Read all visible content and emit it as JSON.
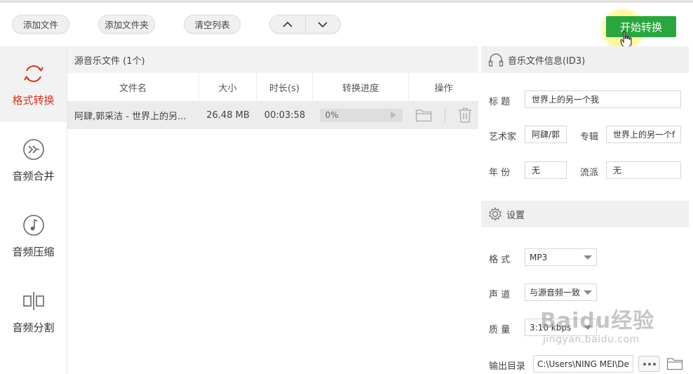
{
  "toolbar": {
    "add_file": "添加文件",
    "add_folder": "添加文件夹",
    "clear_list": "清空列表",
    "start_convert": "开始转换"
  },
  "sidebar": {
    "items": [
      {
        "label": "格式转换",
        "icon": "refresh-icon",
        "active": true
      },
      {
        "label": "音频合并",
        "icon": "merge-icon",
        "active": false
      },
      {
        "label": "音频压缩",
        "icon": "music-note-icon",
        "active": false
      },
      {
        "label": "音频分割",
        "icon": "split-icon",
        "active": false
      }
    ]
  },
  "file_list": {
    "title": "源音乐文件 (1个)",
    "columns": [
      "文件名",
      "大小",
      "时长(s)",
      "转换进度",
      "操作"
    ],
    "rows": [
      {
        "name": "阿肆,郭采洁 - 世界上的另...",
        "size": "26.48 MB",
        "duration": "00:03:58",
        "progress": "0%"
      }
    ]
  },
  "info": {
    "title": "音乐文件信息(ID3)",
    "labels": {
      "title": "标    题",
      "artist": "艺术家",
      "album": "专辑",
      "year": "年    份",
      "genre": "流派"
    },
    "values": {
      "title": "世界上的另一个我",
      "artist": "阿肆/郭",
      "album": "世界上的另一个f",
      "year": "无",
      "genre": "无"
    }
  },
  "settings": {
    "title": "设置",
    "labels": {
      "format": "格    式",
      "channel": "声    道",
      "quality": "质    量",
      "output_dir": "输出目录"
    },
    "values": {
      "format": "MP3",
      "channel": "与源音频一致",
      "quality": "3:10 kbps",
      "output_dir": "C:\\Users\\NING MEI\\De"
    }
  },
  "watermark": {
    "brand": "Baidu经验",
    "url": "jingyan.baidu.com"
  },
  "colors": {
    "accent_green": "#2aa63f",
    "active_red": "#e0321e"
  }
}
